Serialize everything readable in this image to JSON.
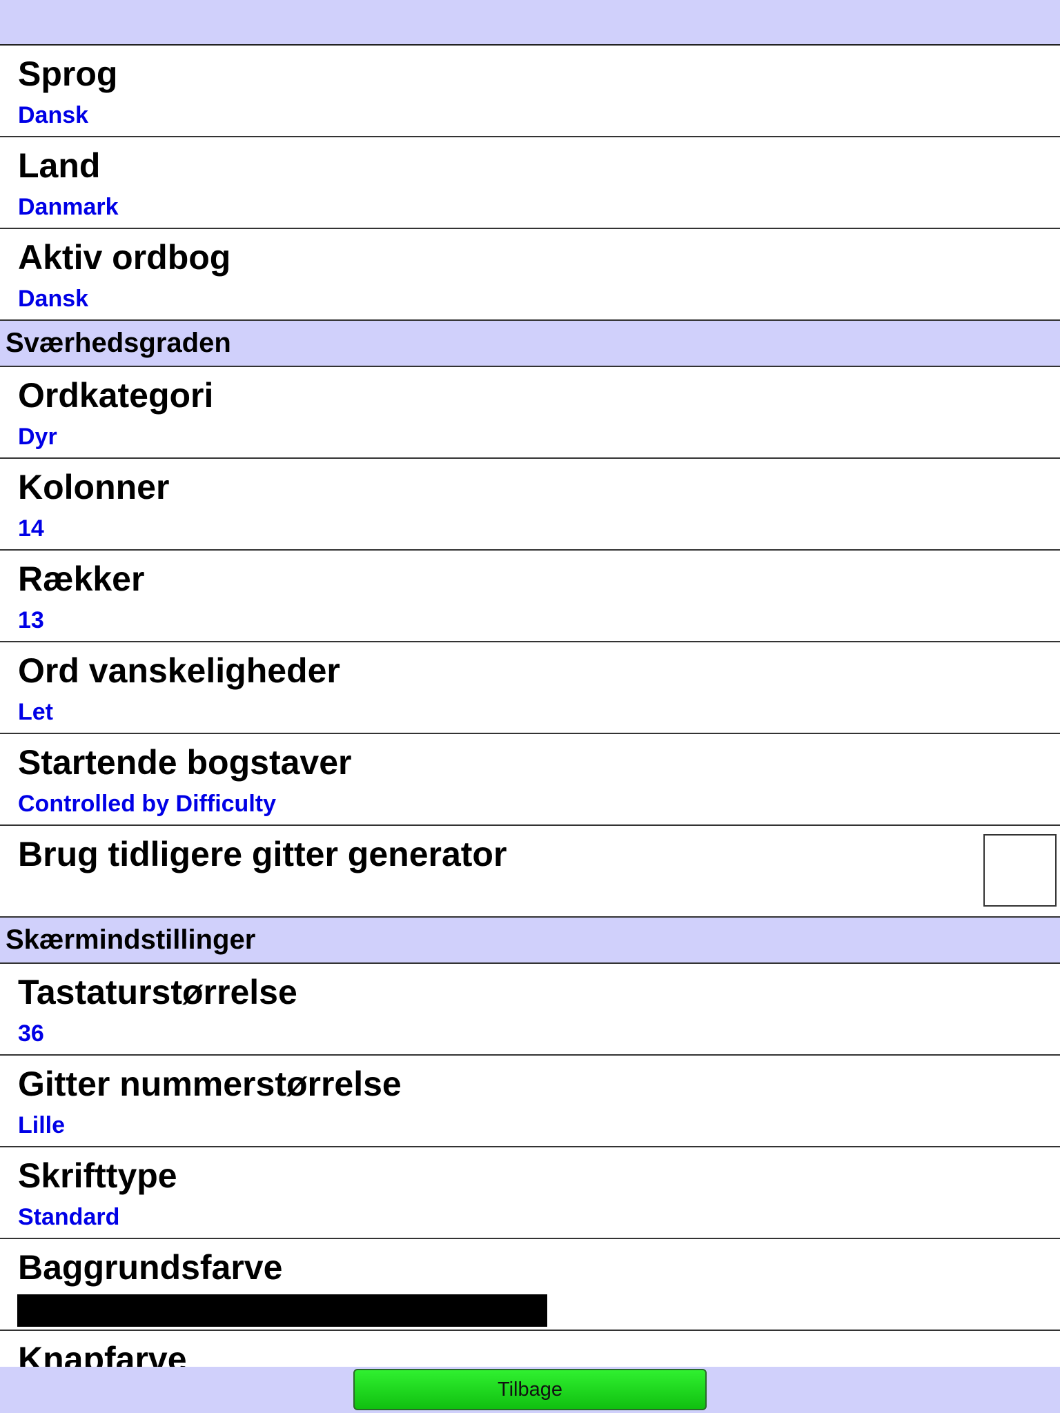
{
  "sections": [
    {
      "header": "",
      "items": [
        {
          "title": "Sprog",
          "value": "Dansk"
        },
        {
          "title": "Land",
          "value": "Danmark"
        },
        {
          "title": "Aktiv ordbog",
          "value": "Dansk"
        }
      ]
    },
    {
      "header": "Sværhedsgraden",
      "items": [
        {
          "title": "Ordkategori",
          "value": "Dyr"
        },
        {
          "title": "Kolonner",
          "value": "14"
        },
        {
          "title": "Rækker",
          "value": "13"
        },
        {
          "title": "Ord vanskeligheder",
          "value": "Let"
        },
        {
          "title": "Startende bogstaver",
          "value": "Controlled by Difficulty"
        },
        {
          "title": "Brug tidligere gitter generator",
          "checked": false
        }
      ]
    },
    {
      "header": "Skærmindstillinger",
      "items": [
        {
          "title": "Tastaturstørrelse",
          "value": "36"
        },
        {
          "title": "Gitter nummerstørrelse",
          "value": "Lille"
        },
        {
          "title": "Skrifttype",
          "value": "Standard"
        },
        {
          "title": "Baggrundsfarve",
          "color": "#000000"
        },
        {
          "title": "Knapfarve"
        }
      ]
    }
  ],
  "footer": {
    "back_label": "Tilbage"
  },
  "colors": {
    "header_bg": "#d0d0fb",
    "value_text": "#0000e6",
    "button_green": "#20e020"
  }
}
